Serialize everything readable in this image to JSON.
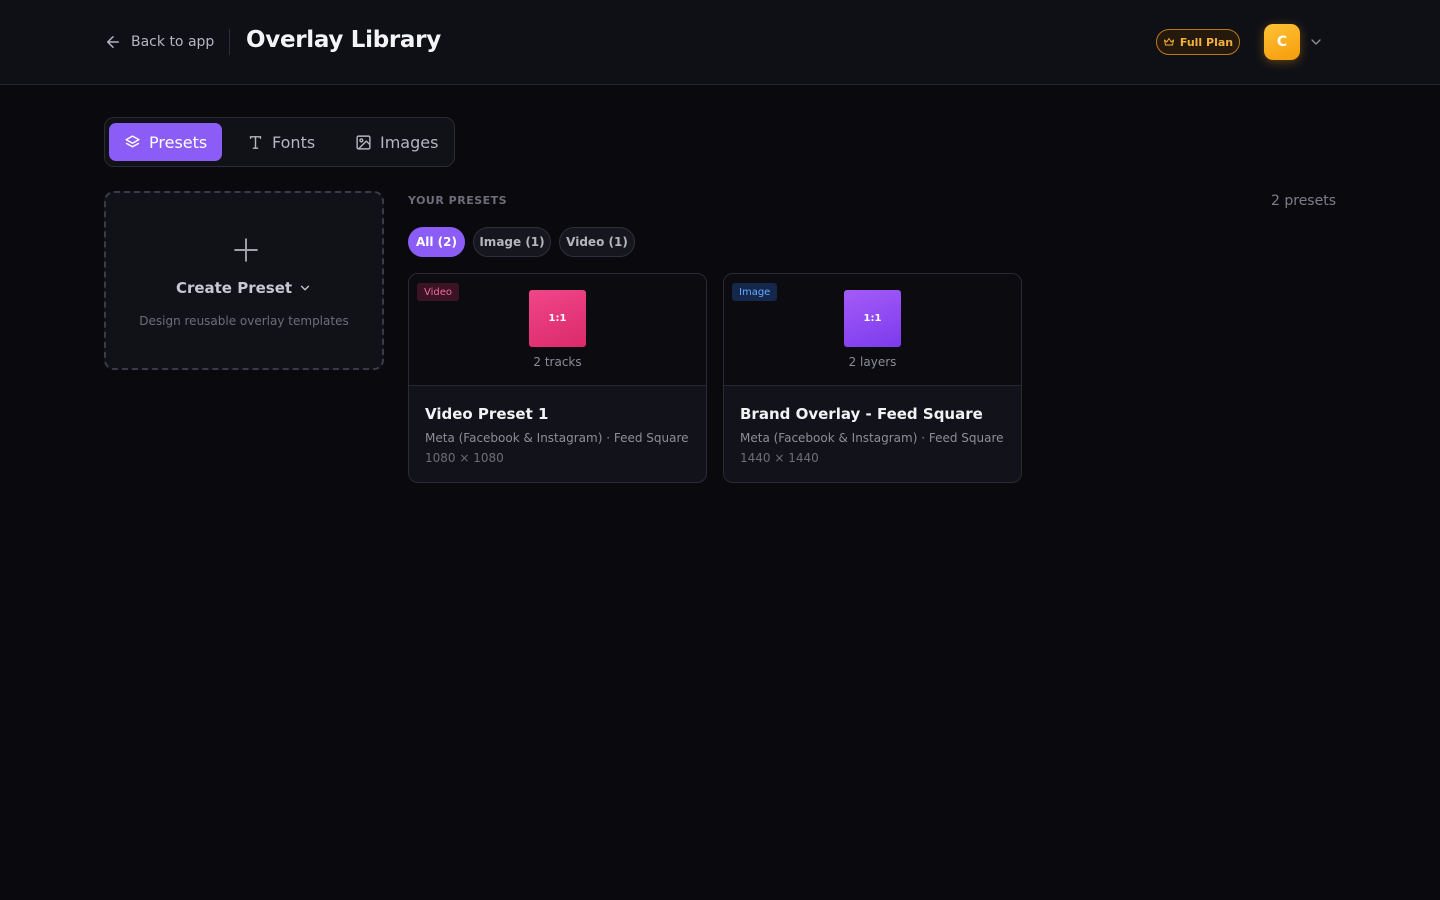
{
  "header": {
    "back_label": "Back to app",
    "title": "Overlay Library",
    "plan_label": "Full Plan",
    "avatar_initial": "C"
  },
  "tabs": [
    {
      "label": "Presets",
      "icon": "layers-icon",
      "active": true
    },
    {
      "label": "Fonts",
      "icon": "type-icon",
      "active": false
    },
    {
      "label": "Images",
      "icon": "image-icon",
      "active": false
    }
  ],
  "create": {
    "label": "Create Preset",
    "subtitle": "Design reusable overlay templates"
  },
  "presets": {
    "section_label": "YOUR PRESETS",
    "count_label": "2 presets",
    "filters": [
      {
        "label": "All (2)",
        "active": true
      },
      {
        "label": "Image (1)",
        "active": false
      },
      {
        "label": "Video (1)",
        "active": false
      }
    ],
    "items": [
      {
        "type": "Video",
        "aspect": "1:1",
        "meta": "2 tracks",
        "title": "Video Preset 1",
        "platform": "Meta (Facebook & Instagram) · Feed Square",
        "dims": "1080 × 1080"
      },
      {
        "type": "Image",
        "aspect": "1:1",
        "meta": "2 layers",
        "title": "Brand Overlay - Feed Square",
        "platform": "Meta (Facebook & Instagram) · Feed Square",
        "dims": "1440 × 1440"
      }
    ]
  },
  "colors": {
    "accent": "#8b5cf6",
    "plan_gold": "#f3b03e",
    "video_tag": "#f26a98",
    "image_tag": "#6aa8ff"
  }
}
